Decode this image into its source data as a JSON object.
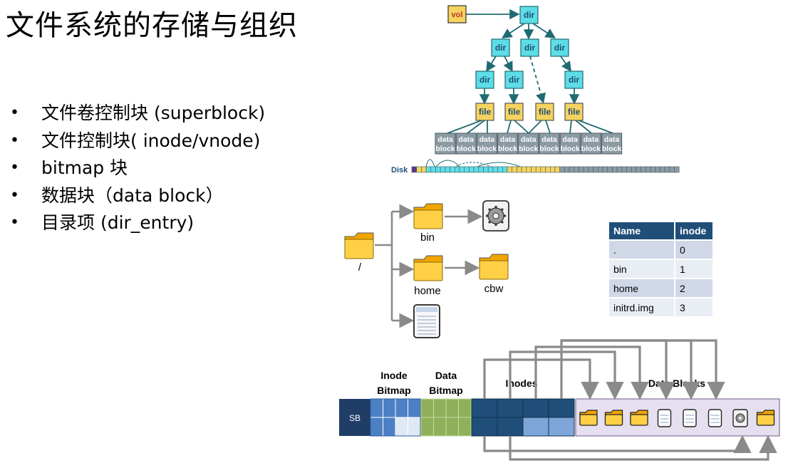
{
  "title": "文件系统的存储与组织",
  "bullets": [
    "文件卷控制块 (superblock)",
    "文件控制块( inode/vnode)",
    "bitmap 块",
    "数据块（data block）",
    "目录项 (dir_entry)"
  ],
  "tree": {
    "vol": "vol",
    "dir": "dir",
    "file": "file",
    "data_block_line1": "data",
    "data_block_line2": "block",
    "disk": "Disk"
  },
  "fs_tree": {
    "root": "/",
    "bin": "bin",
    "home": "home",
    "cbw": "cbw"
  },
  "dir_table": {
    "headers": [
      "Name",
      "inode"
    ],
    "rows": [
      [
        ".",
        "0"
      ],
      [
        "bin",
        "1"
      ],
      [
        "home",
        "2"
      ],
      [
        "initrd.img",
        "3"
      ]
    ]
  },
  "layout_diagram": {
    "sb": "SB",
    "inode_bitmap_1": "Inode",
    "inode_bitmap_2": "Bitmap",
    "data_bitmap_1": "Data",
    "data_bitmap_2": "Bitmap",
    "inodes": "Inodes",
    "data_blocks": "Data Blocks"
  },
  "colors": {
    "dir": "#5ddde6",
    "file": "#f4d35e",
    "data_block": "#8c9ba3",
    "table_header": "#1f4e79",
    "inode_dark": "#1f4e79",
    "bitmap_blue": "#4d7fc4",
    "bitmap_green": "#8fb05a",
    "data_region": "#e6dfef"
  }
}
